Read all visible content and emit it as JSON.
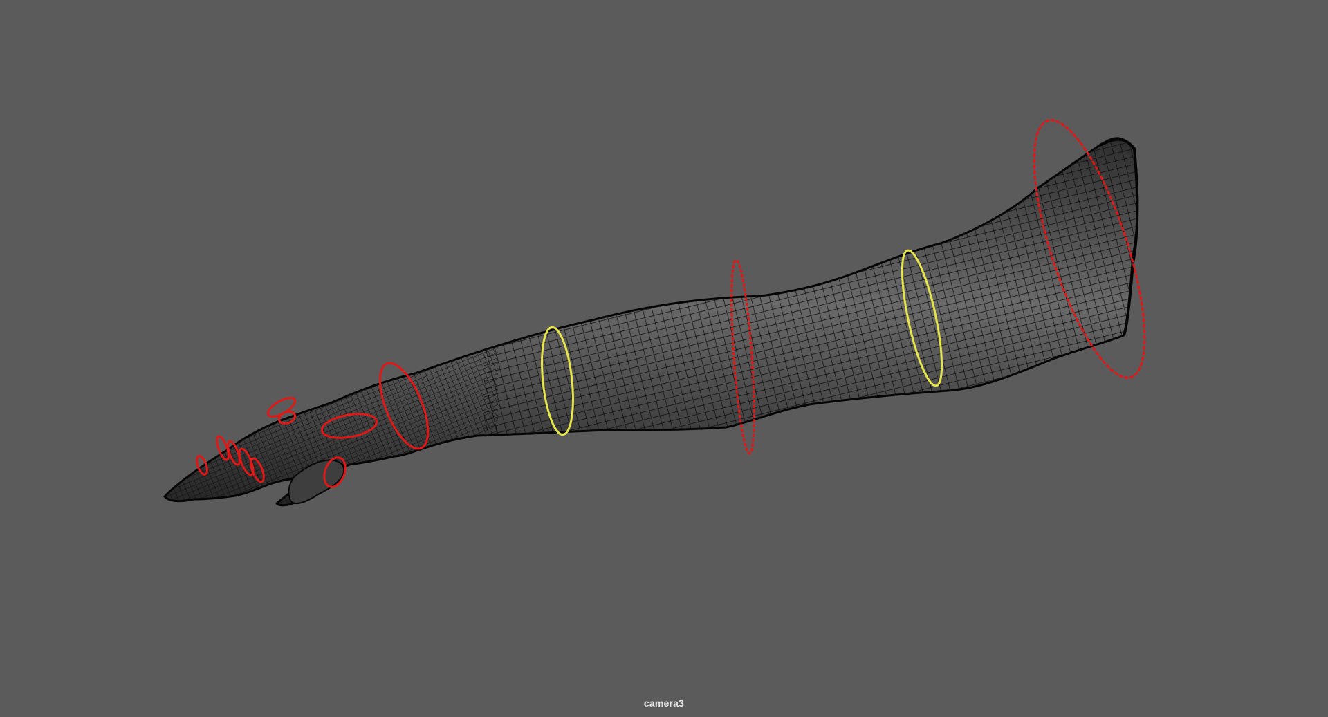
{
  "viewport": {
    "camera_name": "camera3",
    "background_color": "#5b5b5b",
    "mesh_display": "wireframe-on-shaded",
    "mesh_color": "#3a3a3a",
    "wire_color": "#0c0c0c"
  },
  "scene": {
    "object": "arm-mesh",
    "controls": {
      "fk_color": "#e01818",
      "twist_color": "#e6e64a",
      "items": [
        {
          "name": "shoulder-control",
          "type": "fk"
        },
        {
          "name": "upper-arm-twist-control",
          "type": "twist"
        },
        {
          "name": "elbow-control",
          "type": "fk"
        },
        {
          "name": "forearm-twist-control",
          "type": "twist"
        },
        {
          "name": "wrist-control",
          "type": "fk"
        },
        {
          "name": "palm-control",
          "type": "fk"
        },
        {
          "name": "thumb-control",
          "type": "fk"
        },
        {
          "name": "finger-controls",
          "type": "fk"
        }
      ]
    }
  }
}
